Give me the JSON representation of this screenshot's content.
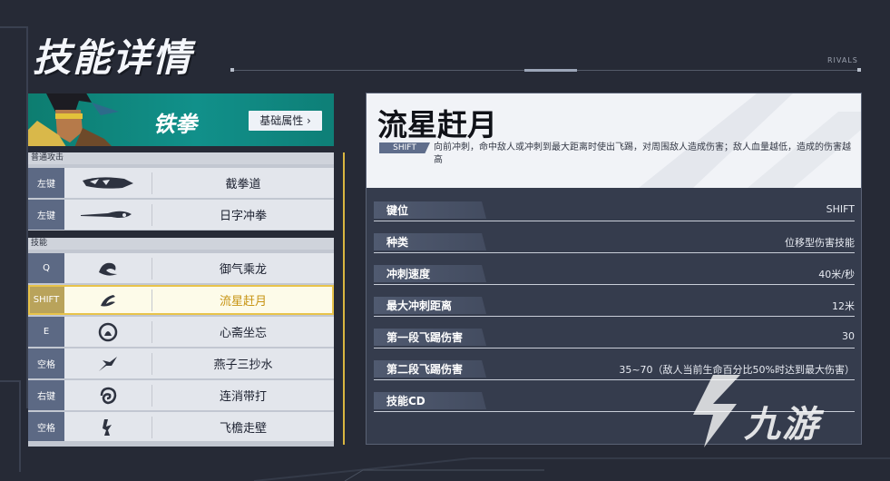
{
  "page": {
    "title": "技能详情",
    "corner_tag": "RIVALS"
  },
  "hero": {
    "name": "铁拳",
    "attributes_button": "基础属性 ›"
  },
  "sections": [
    {
      "title": "普通攻击",
      "rows": [
        {
          "key": "左键",
          "name": "截拳道",
          "icon": "fist-strike-icon"
        },
        {
          "key": "左键",
          "name": "日字冲拳",
          "icon": "dash-punch-icon"
        }
      ]
    },
    {
      "title": "技能",
      "rows": [
        {
          "key": "Q",
          "name": "御气乘龙",
          "icon": "dragon-icon"
        },
        {
          "key": "SHIFT",
          "name": "流星赶月",
          "icon": "meteor-kick-icon",
          "selected": true
        },
        {
          "key": "E",
          "name": "心斋坐忘",
          "icon": "meditation-icon"
        },
        {
          "key": "空格",
          "name": "燕子三抄水",
          "icon": "swallow-leap-icon"
        },
        {
          "key": "右键",
          "name": "连消带打",
          "icon": "counter-strike-icon"
        },
        {
          "key": "空格",
          "name": "飞檐走壁",
          "icon": "wall-run-icon"
        }
      ]
    }
  ],
  "detail": {
    "skill_name": "流星赶月",
    "key_badge": "SHIFT",
    "description": "向前冲刺，命中敌人或冲刺到最大距离时使出飞踢，对周围敌人造成伤害；敌人血量越低，造成的伤害越高",
    "stats": [
      {
        "label": "键位",
        "value": "SHIFT"
      },
      {
        "label": "种类",
        "value": "位移型伤害技能"
      },
      {
        "label": "冲刺速度",
        "value": "40米/秒"
      },
      {
        "label": "最大冲刺距离",
        "value": "12米"
      },
      {
        "label": "第一段飞踢伤害",
        "value": "30"
      },
      {
        "label": "第二段飞踢伤害",
        "value": "35~70（敌人当前生命百分比50%时达到最大伤害）"
      },
      {
        "label": "技能CD",
        "value": ""
      }
    ]
  },
  "watermark": {
    "text": "九游"
  },
  "colors": {
    "accent_teal": "#11908a",
    "highlight_gold": "#e8c34a",
    "key_bg": "#5c6984"
  }
}
